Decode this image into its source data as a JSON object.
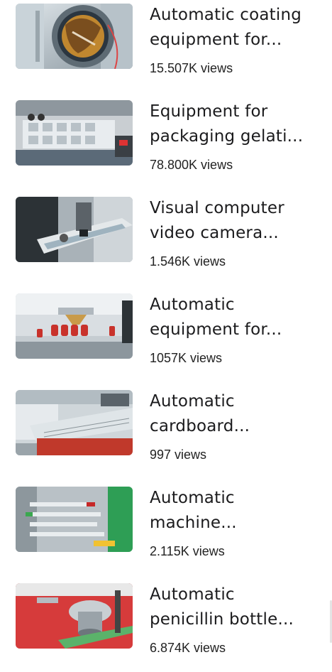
{
  "videos": [
    {
      "title_line1": "Automatic coating",
      "title_line2": "equipment for...",
      "views": "15.507K views",
      "thumb_icon": "coating-machine-thumbnail"
    },
    {
      "title_line1": "Equipment for",
      "title_line2": "packaging gelati...",
      "views": "78.800K views",
      "thumb_icon": "blister-packaging-thumbnail"
    },
    {
      "title_line1": "Visual computer",
      "title_line2": "video camera...",
      "views": "1.546K views",
      "thumb_icon": "vision-inspection-thumbnail"
    },
    {
      "title_line1": "Automatic",
      "title_line2": "equipment for...",
      "views": "1057K views",
      "thumb_icon": "bottle-filling-thumbnail"
    },
    {
      "title_line1": "Automatic",
      "title_line2": "cardboard...",
      "views": "997 views",
      "thumb_icon": "cartoning-machine-thumbnail"
    },
    {
      "title_line1": "Automatic",
      "title_line2": "machine...",
      "views": "2.115K views",
      "thumb_icon": "syringe-assembly-thumbnail"
    },
    {
      "title_line1": "Automatic",
      "title_line2": "penicillin bottle...",
      "views": "6.874K views",
      "thumb_icon": "penicillin-bottle-thumbnail"
    }
  ],
  "colors": {
    "title": "#1b1b1d",
    "views": "#222222",
    "background": "#ffffff"
  }
}
